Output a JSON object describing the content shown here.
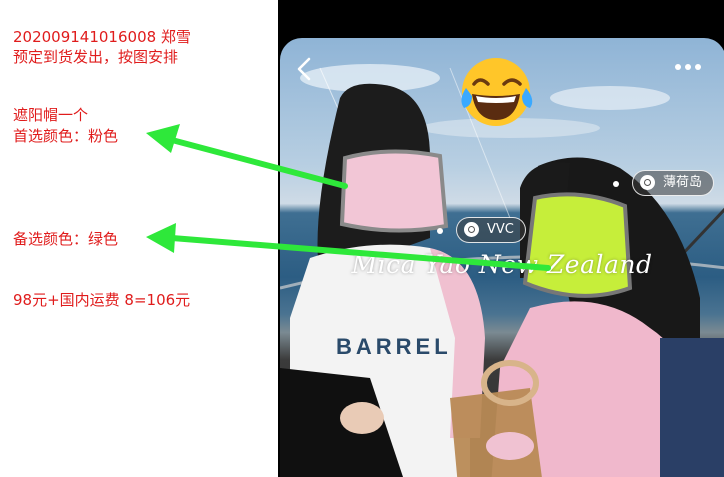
{
  "notes": {
    "order_line": "202009141016008   郑雪",
    "plan_line": "预定到货发出，按图安排",
    "item_line": "遮阳帽一个",
    "first_choice": "首选颜色：粉色",
    "second_choice": "备选颜色：绿色",
    "price_line": "98元+国内运费 8=106元"
  },
  "photo": {
    "watermark": "Mica Yao New Zealand",
    "shirt_text": "BARREL",
    "tags": [
      {
        "label": "VVC",
        "icon": "location-tag-icon"
      },
      {
        "label": "薄荷岛",
        "icon": "location-tag-icon"
      }
    ]
  },
  "colors": {
    "note_text": "#e01c1c",
    "arrow": "#2ee83a",
    "visor_pink": "#f2c6d6",
    "visor_green": "#c6ee3a"
  },
  "icons": {
    "back": "chevron-left-icon",
    "more": "more-dots-icon",
    "emoji": "laughing-tears-emoji-icon"
  }
}
